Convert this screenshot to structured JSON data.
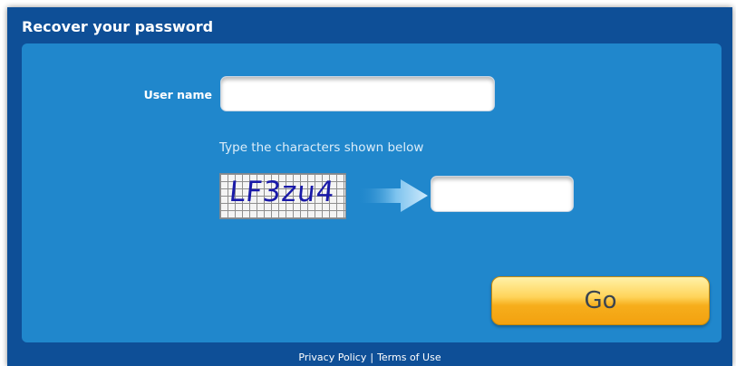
{
  "window": {
    "title": "Recover your password"
  },
  "form": {
    "username_label": "User name",
    "username_value": "",
    "captcha_instruction": "Type the characters shown below",
    "captcha_text": "LF3zu4",
    "captcha_value": "",
    "submit_label": "Go"
  },
  "footer": {
    "privacy_label": "Privacy Policy",
    "separator": "|",
    "terms_label": "Terms of Use"
  },
  "colors": {
    "window_bg": "#0e4f97",
    "panel_bg": "#2087cc",
    "button_gold": "#f6ae1c",
    "captcha_ink": "#1a1aa8"
  },
  "icons": {
    "arrow": "arrow-right-icon"
  }
}
